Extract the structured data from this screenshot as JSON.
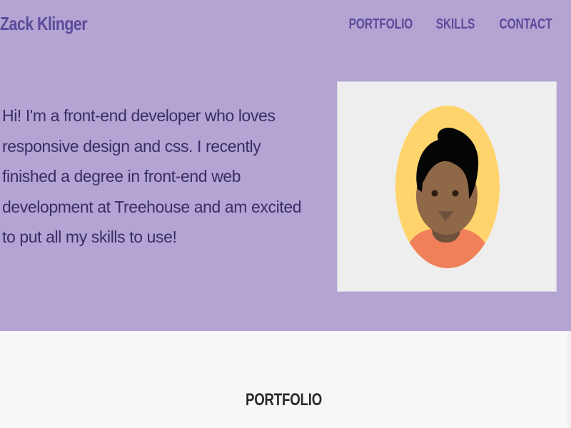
{
  "header": {
    "brand": "Zack Klinger",
    "nav": [
      {
        "label": "PORTFOLIO"
      },
      {
        "label": "SKILLS"
      },
      {
        "label": "CONTACT"
      }
    ]
  },
  "intro": {
    "text": "Hi! I'm a front-end developer who loves responsive design and css. I recently finished a degree in front-end web development at Treehouse and am excited to put all my skills to use!"
  },
  "avatar": {
    "icon": "avatar-icon",
    "colors": {
      "background": "#efeeee",
      "circle": "#ffd46c",
      "skin": "#8f6848",
      "skin_shadow": "#6f523d",
      "hair": "#050505",
      "shirt": "#f0805a"
    }
  },
  "sections": {
    "portfolio_title": "PORTFOLIO"
  },
  "colors": {
    "page_bg": "#b3a4d3",
    "accent": "#5c4a9a",
    "body_text": "#3a2d66",
    "section_bg": "#f7f6f8"
  }
}
